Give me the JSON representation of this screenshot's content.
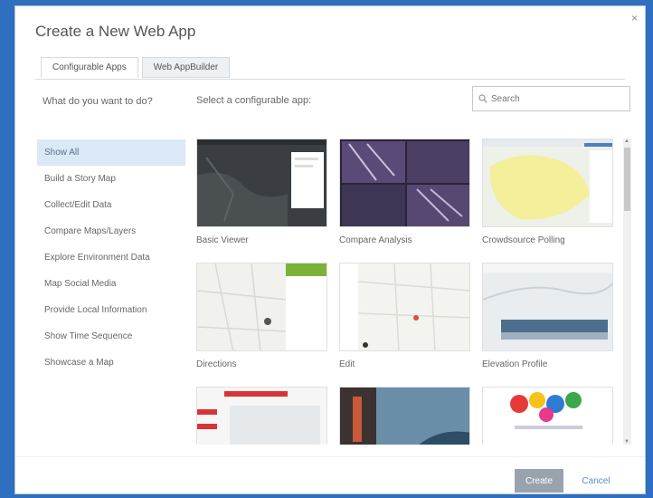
{
  "dialog": {
    "title": "Create a New Web App",
    "close_label": "×",
    "tabs": [
      {
        "label": "Configurable Apps",
        "active": true
      },
      {
        "label": "Web AppBuilder",
        "active": false
      }
    ]
  },
  "sidebar": {
    "question": "What do you want to do?",
    "categories": [
      {
        "label": "Show All",
        "selected": true
      },
      {
        "label": "Build a Story Map"
      },
      {
        "label": "Collect/Edit Data"
      },
      {
        "label": "Compare Maps/Layers"
      },
      {
        "label": "Explore Environment Data"
      },
      {
        "label": "Map Social Media"
      },
      {
        "label": "Provide Local Information"
      },
      {
        "label": "Show Time Sequence"
      },
      {
        "label": "Showcase a Map"
      }
    ]
  },
  "main": {
    "prompt": "Select a configurable app:",
    "search": {
      "placeholder": "Search",
      "value": ""
    },
    "apps": [
      {
        "label": "Basic Viewer",
        "thumb_icon": "dark-map-thumbnail"
      },
      {
        "label": "Compare Analysis",
        "thumb_icon": "purple-imagery-thumbnail"
      },
      {
        "label": "Crowdsource Polling",
        "thumb_icon": "yellow-map-thumbnail"
      },
      {
        "label": "Directions",
        "thumb_icon": "street-map-thumbnail"
      },
      {
        "label": "Edit",
        "thumb_icon": "street-map-thumbnail"
      },
      {
        "label": "Elevation Profile",
        "thumb_icon": "profile-map-thumbnail"
      },
      {
        "label": "",
        "thumb_icon": "red-header-thumbnail"
      },
      {
        "label": "",
        "thumb_icon": "photo-thumbnail"
      },
      {
        "label": "",
        "thumb_icon": "colorful-shapes-thumbnail"
      }
    ]
  },
  "footer": {
    "create_label": "Create",
    "cancel_label": "Cancel"
  },
  "colors": {
    "background": "#2f6fbf",
    "selected_category": "#dbe8f6",
    "link": "#5b8cc8",
    "primary_button": "#9aa3ad"
  }
}
